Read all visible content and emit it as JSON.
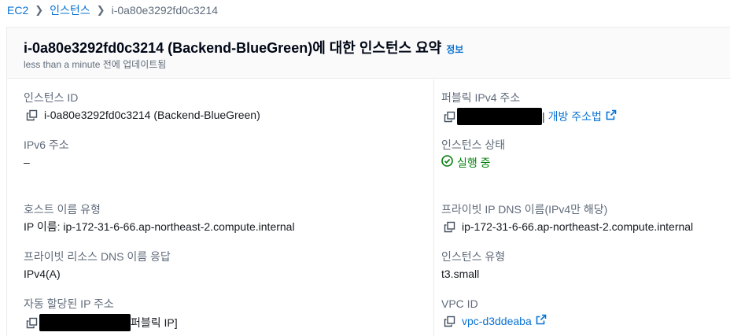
{
  "breadcrumb": {
    "ec2": "EC2",
    "instances": "인스턴스",
    "current": "i-0a80e3292fd0c3214",
    "separator": "❯"
  },
  "header": {
    "title": "i-0a80e3292fd0c3214 (Backend-BlueGreen)에 대한 인스턴스 요약",
    "info": "정보",
    "updated": "less than a minute 전에 업데이트됨"
  },
  "fields": {
    "instance_id": {
      "label": "인스턴스 ID",
      "value": "i-0a80e3292fd0c3214 (Backend-BlueGreen)"
    },
    "public_ipv4": {
      "label": "퍼블릭 IPv4 주소",
      "divider": "|",
      "open_address": "개방 주소법"
    },
    "ipv6": {
      "label": "IPv6 주소",
      "value": "–"
    },
    "instance_state": {
      "label": "인스턴스 상태",
      "value": "실행 중"
    },
    "hostname_type": {
      "label": "호스트 이름 유형",
      "value": "IP 이름: ip-172-31-6-66.ap-northeast-2.compute.internal"
    },
    "private_ip_dns": {
      "label": "프라이빗 IP DNS 이름(IPv4만 해당)",
      "value": "ip-172-31-6-66.ap-northeast-2.compute.internal"
    },
    "private_resource_dns": {
      "label": "프라이빗 리소스 DNS 이름 응답",
      "value": "IPv4(A)"
    },
    "instance_type": {
      "label": "인스턴스 유형",
      "value": "t3.small"
    },
    "auto_ip": {
      "label": "자동 할당된 IP 주소",
      "suffix": "퍼블릭 IP]"
    },
    "vpc_id": {
      "label": "VPC ID",
      "value": "vpc-d3ddeaba"
    }
  },
  "colors": {
    "link": "#0972d3",
    "success": "#037f0c",
    "label": "#5f6b7a",
    "text": "#16191f"
  }
}
